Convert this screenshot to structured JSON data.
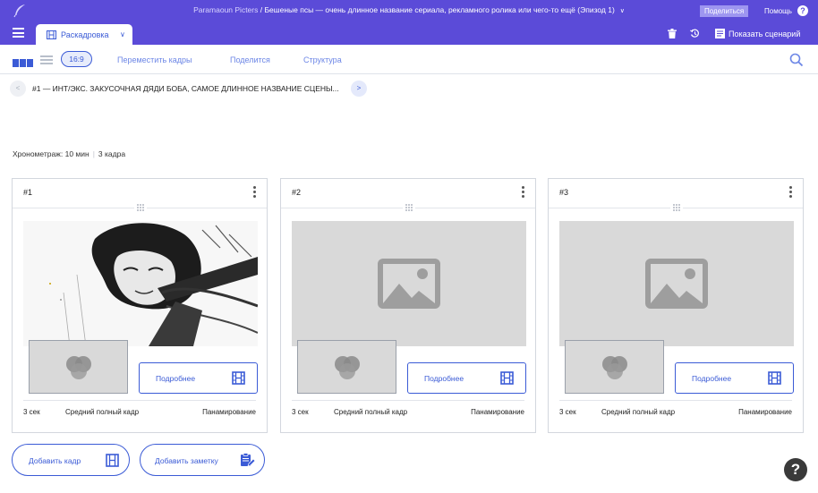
{
  "topbar": {
    "company": "Paramaoun Picters",
    "separator": " / ",
    "project_title": "Бешеные псы — очень длинное название сериала, рекламного ролика или чего-то ещё (Эпизод 1)",
    "project_chevron": "∨",
    "share_label": "Поделиться",
    "help_label": "Помощь",
    "help_icon": "?"
  },
  "tabbar": {
    "active_tab_label": "Раскадровка",
    "active_tab_chevron": "∨",
    "show_script_label": "Показать сценарий"
  },
  "toolbar": {
    "ratio_label": "16:9",
    "move_frames_label": "Переместить кадры",
    "share_label": "Поделится",
    "structure_label": "Структура"
  },
  "scene": {
    "prev_label": "<",
    "next_label": ">",
    "title": "#1 — ИНТ/ЭКС. ЗАКУСОЧНАЯ ДЯДИ БОБА, САМОЕ ДЛИННОЕ НАЗВАНИЕ СЦЕНЫ..."
  },
  "summary": {
    "duration": "Хронометраж: 10 мин",
    "separator": "|",
    "frame_count": "3 кадра"
  },
  "frames": [
    {
      "number": "#1",
      "image": "sketch",
      "details_label": "Подробнее",
      "duration": "3 сек",
      "shot": "Средний полный кадр",
      "movement": "Панамирование"
    },
    {
      "number": "#2",
      "image": "placeholder",
      "details_label": "Подробнее",
      "duration": "3 сек",
      "shot": "Средний полный кадр",
      "movement": "Панамирование"
    },
    {
      "number": "#3",
      "image": "placeholder",
      "details_label": "Подробнее",
      "duration": "3 сек",
      "shot": "Средний полный кадр",
      "movement": "Панамирование"
    }
  ],
  "actions": {
    "add_frame_label": "Добавить кадр",
    "add_note_label": "Добавить заметку"
  },
  "help_fab": "?",
  "colors": {
    "brand": "#5b4bd8",
    "accent": "#3b5bd6",
    "placeholder": "#d9d9d9",
    "placeholder_icon": "#9e9e9e"
  }
}
